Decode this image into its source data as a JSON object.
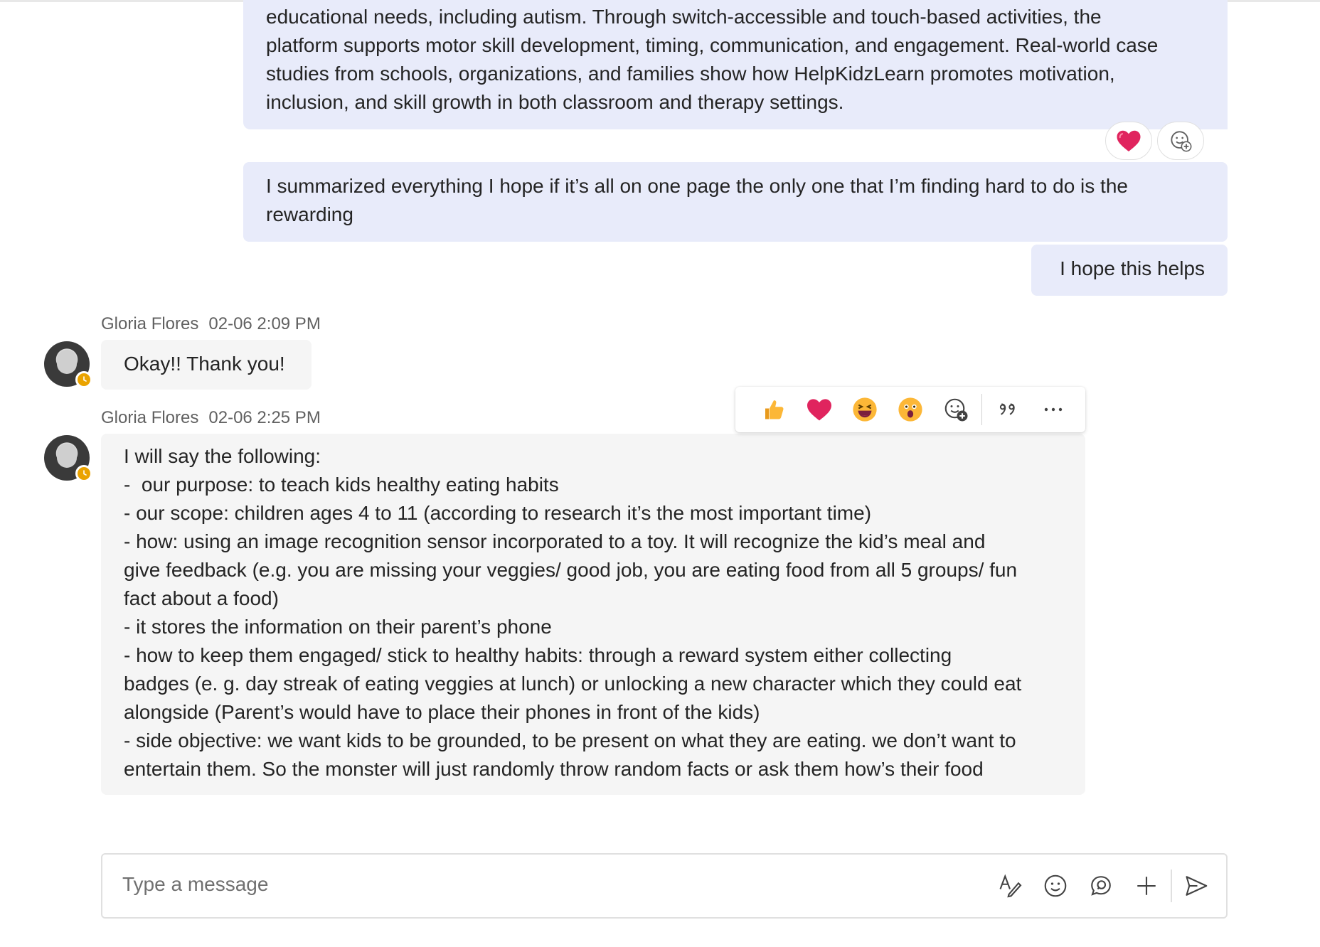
{
  "messages_self": {
    "top": {
      "lines": [
        "educational needs, including autism. Through switch-accessible and touch-based activities, the",
        "platform supports motor skill development, timing, communication, and engagement. Real-world case",
        "studies from schools, organizations, and families show how HelpKidzLearn promotes motivation,",
        "inclusion, and skill growth in both classroom and therapy settings."
      ],
      "reactions": [
        "heart-reaction",
        "add-reaction"
      ]
    },
    "summarized": {
      "lines": [
        "I summarized everything I hope if it’s all on one page the only one that I’m finding hard to do is the",
        "rewarding"
      ]
    },
    "hope": {
      "text": "I hope this helps"
    }
  },
  "messages_other": [
    {
      "sender": "Gloria Flores",
      "time": "02-06 2:09 PM",
      "text": "Okay!! Thank you!"
    },
    {
      "sender": "Gloria Flores",
      "time": "02-06 2:25 PM",
      "lines": [
        "I will say the following:",
        "-  our purpose: to teach kids healthy eating habits",
        "- our scope: children ages 4 to 11 (according to research it’s the most important time)",
        "- how: using an image recognition sensor incorporated to a toy. It will recognize the kid’s meal and",
        "give feedback (e.g. you are missing your veggies/ good job, you are eating food from all 5 groups/ fun",
        "fact about a food)",
        "- it stores the information on their parent’s phone",
        "- how to keep them engaged/ stick to healthy habits: through a reward system either collecting",
        "badges (e. g. day streak of eating veggies at lunch) or unlocking a new character which they could eat",
        "alongside (Parent’s would have to place their phones in front of the kids)",
        "- side objective: we want kids to be grounded, to be present on what they are eating. we don’t want to",
        "entertain them. So the monster will just randomly throw random facts or ask them how’s their food"
      ]
    }
  ],
  "reaction_bar": {
    "items": [
      "thumbs-up-icon",
      "heart-icon",
      "laughing-icon",
      "surprised-icon",
      "add-reaction-icon",
      "quote-icon",
      "more-options-icon"
    ]
  },
  "composer": {
    "placeholder": "Type a message",
    "tools": [
      "format-icon",
      "emoji-icon",
      "loop-icon",
      "attach-plus-icon",
      "send-icon"
    ]
  },
  "colors": {
    "self_bubble": "#e8ebfa",
    "other_bubble": "#f5f5f5",
    "status_away": "#eaa300",
    "heart": "#e0245e"
  }
}
